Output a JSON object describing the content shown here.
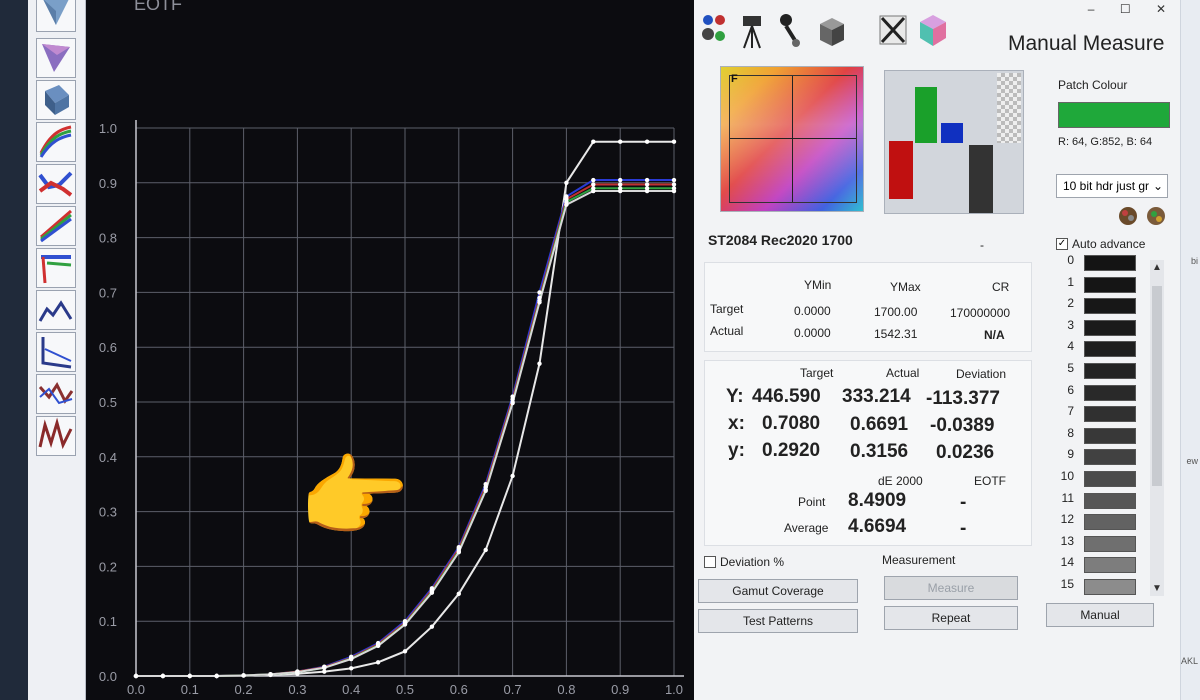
{
  "window": {
    "title": "Manual Measure",
    "controls": [
      "–",
      "☐",
      "✕"
    ]
  },
  "toolstrip": {
    "tools": [
      "luminance-icon",
      "gamut-triangle-icon",
      "cube-icon",
      "rgb-balance-icon",
      "rgb-error-icon",
      "gamma-icon",
      "eotf-icon",
      "delta-e-icon",
      "deviation-icon",
      "graph-icon",
      "chart-icon"
    ]
  },
  "chart_data": {
    "type": "line",
    "title": "EOTF",
    "xlim": [
      0,
      1.0
    ],
    "ylim": [
      0,
      1.0
    ],
    "x_ticks": [
      "0.0",
      "0.1",
      "0.2",
      "0.3",
      "0.4",
      "0.5",
      "0.6",
      "0.7",
      "0.8",
      "0.9",
      "1.0"
    ],
    "y_ticks": [
      "0.0",
      "0.1",
      "0.2",
      "0.3",
      "0.4",
      "0.5",
      "0.6",
      "0.7",
      "0.8",
      "0.9",
      "1.0"
    ],
    "grid": true,
    "x": [
      0.0,
      0.05,
      0.1,
      0.15,
      0.2,
      0.25,
      0.3,
      0.35,
      0.4,
      0.45,
      0.5,
      0.55,
      0.6,
      0.65,
      0.7,
      0.75,
      0.8,
      0.85,
      0.9,
      0.95,
      1.0
    ],
    "series": [
      {
        "color": "#e8e8e8",
        "values": [
          0.0,
          0.0,
          0.0,
          0.0,
          0.001,
          0.002,
          0.004,
          0.008,
          0.014,
          0.025,
          0.045,
          0.09,
          0.15,
          0.23,
          0.365,
          0.57,
          0.9,
          0.975,
          0.975,
          0.975,
          0.975
        ]
      },
      {
        "color": "#2a3bd6",
        "values": [
          0.0,
          0.0,
          0.0,
          0.0,
          0.001,
          0.003,
          0.008,
          0.017,
          0.035,
          0.06,
          0.1,
          0.16,
          0.235,
          0.35,
          0.51,
          0.7,
          0.875,
          0.905,
          0.905,
          0.905,
          0.905
        ]
      },
      {
        "color": "#c03030",
        "values": [
          0.0,
          0.0,
          0.0,
          0.0,
          0.001,
          0.003,
          0.008,
          0.016,
          0.033,
          0.058,
          0.097,
          0.157,
          0.232,
          0.345,
          0.505,
          0.69,
          0.87,
          0.897,
          0.897,
          0.897,
          0.897
        ]
      },
      {
        "color": "#30a040",
        "values": [
          0.0,
          0.0,
          0.0,
          0.0,
          0.001,
          0.003,
          0.007,
          0.015,
          0.032,
          0.056,
          0.095,
          0.154,
          0.228,
          0.34,
          0.5,
          0.685,
          0.865,
          0.89,
          0.89,
          0.89,
          0.89
        ]
      },
      {
        "color": "#d8d8d8",
        "values": [
          0.0,
          0.0,
          0.0,
          0.0,
          0.001,
          0.003,
          0.007,
          0.015,
          0.031,
          0.055,
          0.094,
          0.152,
          0.226,
          0.338,
          0.498,
          0.682,
          0.86,
          0.885,
          0.885,
          0.885,
          0.885
        ]
      }
    ]
  },
  "pointer_emoji": "👉",
  "gamut_preview": {
    "marker": "F"
  },
  "patch_colour": {
    "label": "Patch Colour",
    "color": "#1fa83a",
    "rgb_text": "R: 64, G:852, B: 64",
    "dropdown_value": "10 bit hdr just gr"
  },
  "auto_advance": {
    "label": "Auto advance",
    "checked": true
  },
  "profile": {
    "name": "ST2084 Rec2020 1700",
    "dash": "-"
  },
  "range_table": {
    "headers": [
      "YMin",
      "YMax",
      "CR"
    ],
    "rows": [
      {
        "label": "Target",
        "ymin": "0.0000",
        "ymax": "1700.00",
        "cr": "170000000"
      },
      {
        "label": "Actual",
        "ymin": "0.0000",
        "ymax": "1542.31",
        "cr": "N/A"
      }
    ]
  },
  "measure_table": {
    "headers": [
      "Target",
      "Actual",
      "Deviation"
    ],
    "rows": [
      {
        "label": "Y:",
        "target": "446.590",
        "actual": "333.214",
        "deviation": "-113.377"
      },
      {
        "label": "x:",
        "target": "0.7080",
        "actual": "0.6691",
        "deviation": "-0.0389"
      },
      {
        "label": "y:",
        "target": "0.2920",
        "actual": "0.3156",
        "deviation": "0.0236"
      }
    ]
  },
  "de_table": {
    "headers": [
      "dE 2000",
      "EOTF"
    ],
    "rows": [
      {
        "label": "Point",
        "de": "8.4909",
        "eotf": "-"
      },
      {
        "label": "Average",
        "de": "4.6694",
        "eotf": "-"
      }
    ]
  },
  "deviation_pct": {
    "label": "Deviation %",
    "checked": false
  },
  "measurement_group": {
    "label": "Measurement"
  },
  "buttons": {
    "gamut_coverage": "Gamut Coverage",
    "test_patterns": "Test Patterns",
    "measure": "Measure",
    "repeat": "Repeat",
    "manual": "Manual"
  },
  "patches": [
    {
      "n": "0",
      "color": "#141414"
    },
    {
      "n": "1",
      "color": "#151515"
    },
    {
      "n": "2",
      "color": "#171717"
    },
    {
      "n": "3",
      "color": "#1a1a1a"
    },
    {
      "n": "4",
      "color": "#1e1e1e"
    },
    {
      "n": "5",
      "color": "#232323"
    },
    {
      "n": "6",
      "color": "#292929"
    },
    {
      "n": "7",
      "color": "#303030"
    },
    {
      "n": "8",
      "color": "#383838"
    },
    {
      "n": "9",
      "color": "#414141"
    },
    {
      "n": "10",
      "color": "#4b4b4b"
    },
    {
      "n": "11",
      "color": "#565656"
    },
    {
      "n": "12",
      "color": "#626262"
    },
    {
      "n": "13",
      "color": "#6f6f6f"
    },
    {
      "n": "14",
      "color": "#7d7d7d"
    },
    {
      "n": "15",
      "color": "#8c8c8c"
    }
  ],
  "edge_fragments": [
    "bi",
    "ew",
    "AKL"
  ]
}
